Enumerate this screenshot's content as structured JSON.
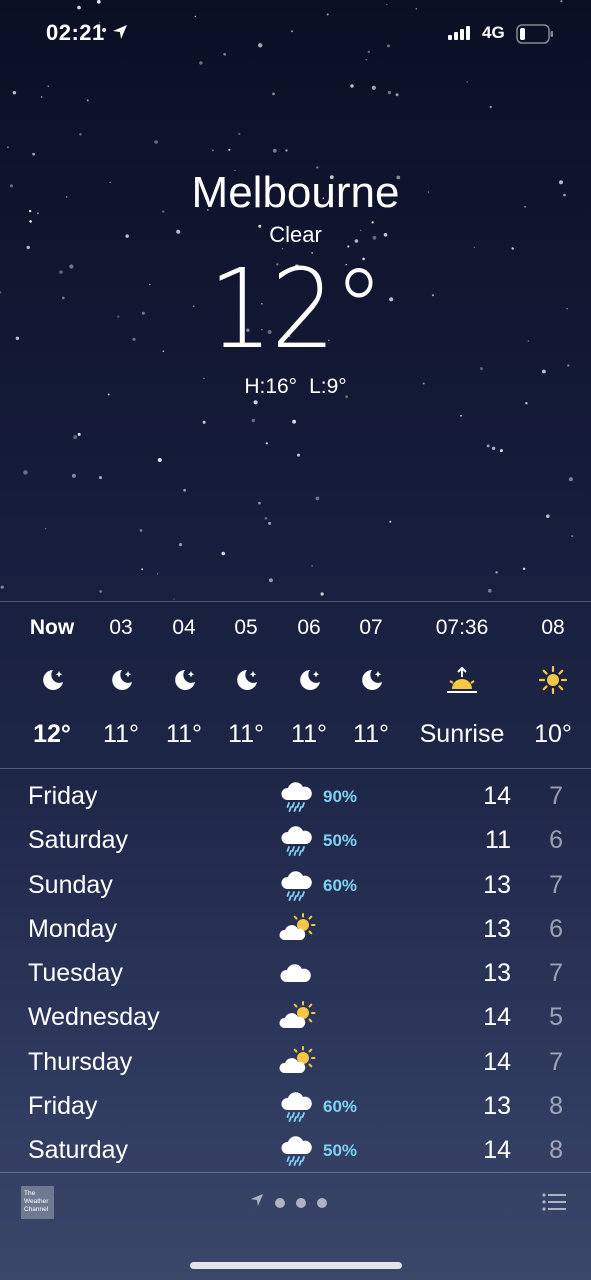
{
  "status_bar": {
    "time": "02:21",
    "network": "4G"
  },
  "location": {
    "city": "Melbourne",
    "condition": "Clear",
    "temperature": "12°",
    "high": "H:16°",
    "low": "L:9°"
  },
  "hourly": [
    {
      "label": "Now",
      "icon": "moon-stars-icon",
      "value": "12°"
    },
    {
      "label": "03",
      "icon": "moon-stars-icon",
      "value": "11°"
    },
    {
      "label": "04",
      "icon": "moon-stars-icon",
      "value": "11°"
    },
    {
      "label": "05",
      "icon": "moon-stars-icon",
      "value": "11°"
    },
    {
      "label": "06",
      "icon": "moon-stars-icon",
      "value": "11°"
    },
    {
      "label": "07",
      "icon": "moon-stars-icon",
      "value": "11°"
    },
    {
      "label": "07:36",
      "icon": "sunrise-icon",
      "value": "Sunrise"
    },
    {
      "label": "08",
      "icon": "sun-icon",
      "value": "10°"
    }
  ],
  "daily": [
    {
      "day": "Friday",
      "icon": "cloud-rain-icon",
      "pop": "90%",
      "high": "14",
      "low": "7"
    },
    {
      "day": "Saturday",
      "icon": "cloud-rain-icon",
      "pop": "50%",
      "high": "11",
      "low": "6"
    },
    {
      "day": "Sunday",
      "icon": "cloud-rain-icon",
      "pop": "60%",
      "high": "13",
      "low": "7"
    },
    {
      "day": "Monday",
      "icon": "partly-cloudy-icon",
      "pop": "",
      "high": "13",
      "low": "6"
    },
    {
      "day": "Tuesday",
      "icon": "cloud-icon",
      "pop": "",
      "high": "13",
      "low": "7"
    },
    {
      "day": "Wednesday",
      "icon": "partly-cloudy-icon",
      "pop": "",
      "high": "14",
      "low": "5"
    },
    {
      "day": "Thursday",
      "icon": "partly-cloudy-icon",
      "pop": "",
      "high": "14",
      "low": "7"
    },
    {
      "day": "Friday",
      "icon": "cloud-rain-icon",
      "pop": "60%",
      "high": "13",
      "low": "8"
    },
    {
      "day": "Saturday",
      "icon": "cloud-rain-icon",
      "pop": "50%",
      "high": "14",
      "low": "8"
    }
  ],
  "footer": {
    "logo_text": "The Weather Channel",
    "page_count": 3
  },
  "colors": {
    "rain_probability": "#7fd0f5",
    "sun": "#f6c744",
    "background_top": "#0b0f24",
    "background_bottom": "#3b4769"
  }
}
